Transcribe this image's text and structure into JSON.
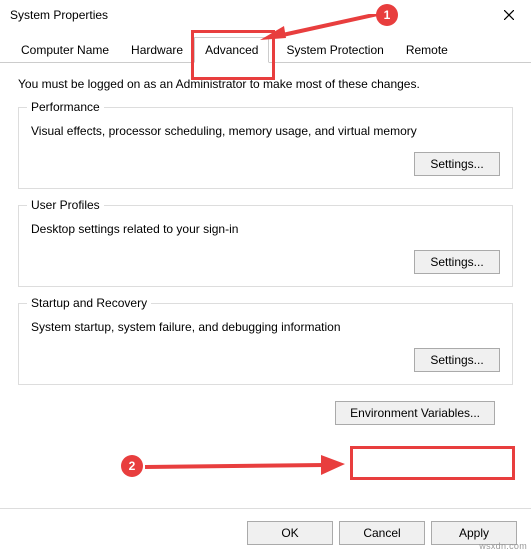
{
  "window": {
    "title": "System Properties"
  },
  "tabs": {
    "computer_name": "Computer Name",
    "hardware": "Hardware",
    "advanced": "Advanced",
    "system_protection": "System Protection",
    "remote": "Remote"
  },
  "content": {
    "admin_note": "You must be logged on as an Administrator to make most of these changes.",
    "performance": {
      "title": "Performance",
      "desc": "Visual effects, processor scheduling, memory usage, and virtual memory",
      "button": "Settings..."
    },
    "user_profiles": {
      "title": "User Profiles",
      "desc": "Desktop settings related to your sign-in",
      "button": "Settings..."
    },
    "startup_recovery": {
      "title": "Startup and Recovery",
      "desc": "System startup, system failure, and debugging information",
      "button": "Settings..."
    },
    "env_vars_button": "Environment Variables..."
  },
  "buttons": {
    "ok": "OK",
    "cancel": "Cancel",
    "apply": "Apply"
  },
  "callouts": {
    "one": "1",
    "two": "2"
  },
  "watermark": "wsxdn.com"
}
